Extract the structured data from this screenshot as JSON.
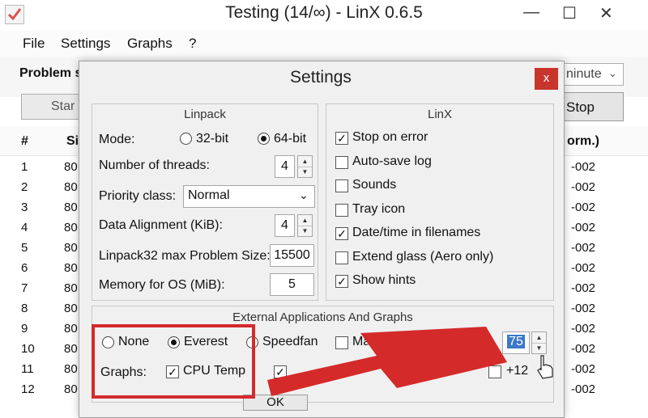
{
  "main": {
    "title": "Testing (14/∞) - LinX 0.6.5",
    "controls": {
      "minimize": "—",
      "maximize": "☐",
      "close": "✕"
    },
    "menu": [
      "File",
      "Settings",
      "Graphs",
      "?"
    ],
    "problem_label": "Problem si",
    "duration_value": "ninute",
    "start_label": "Star",
    "stop_label": "Stop",
    "columns": {
      "num": "#",
      "size": "Si",
      "norm": "orm.)"
    },
    "rows": [
      {
        "num": "1",
        "size": "80",
        "norm": "-002"
      },
      {
        "num": "2",
        "size": "80",
        "norm": "-002"
      },
      {
        "num": "3",
        "size": "80",
        "norm": "-002"
      },
      {
        "num": "4",
        "size": "80",
        "norm": "-002"
      },
      {
        "num": "5",
        "size": "80",
        "norm": "-002"
      },
      {
        "num": "6",
        "size": "80",
        "norm": "-002"
      },
      {
        "num": "7",
        "size": "80",
        "norm": "-002"
      },
      {
        "num": "8",
        "size": "80",
        "norm": "-002"
      },
      {
        "num": "9",
        "size": "80",
        "norm": "-002"
      },
      {
        "num": "10",
        "size": "80",
        "norm": "-002"
      },
      {
        "num": "11",
        "size": "80",
        "norm": "-002"
      },
      {
        "num": "12",
        "size": "80",
        "norm": "-002"
      }
    ]
  },
  "settings": {
    "title": "Settings",
    "close": "x",
    "linpack": {
      "title": "Linpack",
      "mode_label": "Mode:",
      "mode_32": "32-bit",
      "mode_64": "64-bit",
      "mode_selected": "64-bit",
      "threads_label": "Number of threads:",
      "threads_value": "4",
      "priority_label": "Priority class:",
      "priority_value": "Normal",
      "alignment_label": "Data Alignment (KiB):",
      "alignment_value": "4",
      "max_problem_label": "Linpack32 max Problem Size:",
      "max_problem_value": "15500",
      "memory_label": "Memory for OS (MiB):",
      "memory_value": "5"
    },
    "linx": {
      "title": "LinX",
      "options": [
        {
          "label": "Stop on error",
          "checked": true
        },
        {
          "label": "Auto-save log",
          "checked": false
        },
        {
          "label": "Sounds",
          "checked": false
        },
        {
          "label": "Tray icon",
          "checked": false
        },
        {
          "label": "Date/time in filenames",
          "checked": true
        },
        {
          "label": "Extend glass (Aero only)",
          "checked": false
        },
        {
          "label": "Show hints",
          "checked": true
        }
      ]
    },
    "external": {
      "title": "External Applications And Graphs",
      "source_none": "None",
      "source_everest": "Everest",
      "source_speedfan": "Speedfan",
      "source_selected": "Everest",
      "maximum_label": "Maximum all",
      "interval_value": "75",
      "graphs_label": "Graphs:",
      "cpu_temp_label": "CPU Temp",
      "cpu_temp_checked": true,
      "offset_label": "+12"
    },
    "ok_label": "OK"
  },
  "annotation": {
    "highlight_color": "#d42a2a",
    "arrow_color": "#d42a2a"
  },
  "colors": {
    "dialog_close": "#c8352c",
    "selection": "#3b78c8"
  }
}
